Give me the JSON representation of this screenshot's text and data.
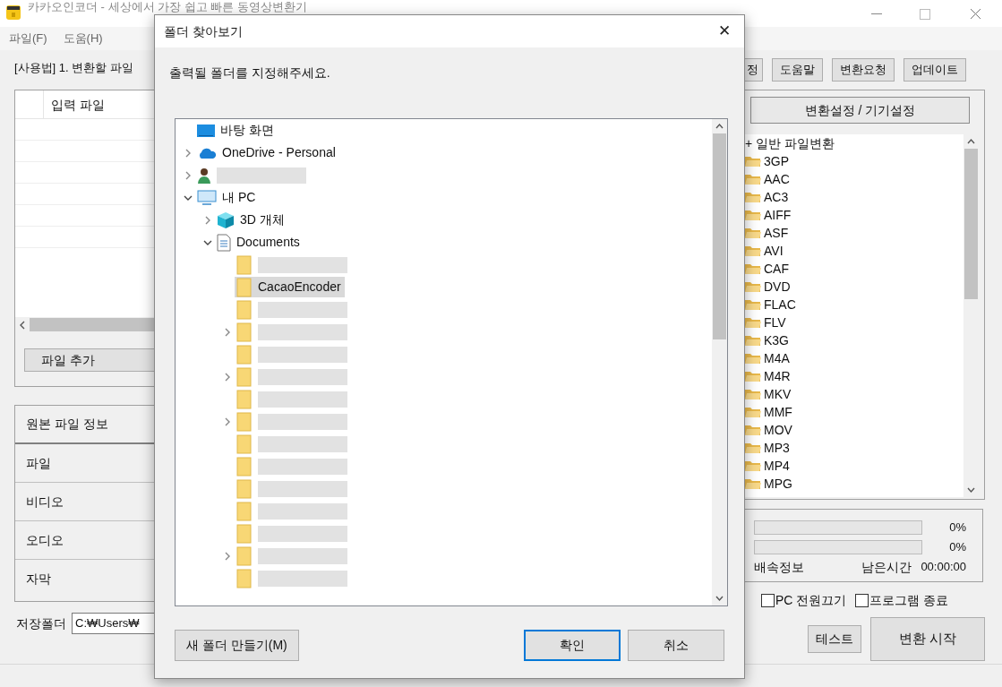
{
  "window": {
    "title": "카카오인코더 - 세상에서 가장 쉽고 빠른 동영상변환기"
  },
  "menu": [
    "파일(F)",
    "도움(H)"
  ],
  "usage": "[사용법] 1. 변환할 파일",
  "file_table": {
    "columns": [
      "입력 파일"
    ]
  },
  "add_file_button": "파일 추가",
  "source_info": {
    "title": "원본 파일 정보",
    "rows": [
      "파일",
      "비디오",
      "오디오",
      "자막"
    ]
  },
  "save_folder": {
    "label": "저장폴더",
    "value": "C:₩Users₩"
  },
  "top_buttons": [
    "정",
    "도움말",
    "변환요청",
    "업데이트"
  ],
  "settings_button": "변환설정 / 기기설정",
  "formats": {
    "header": "+ 일반 파일변환",
    "items": [
      "3GP",
      "AAC",
      "AC3",
      "AIFF",
      "ASF",
      "AVI",
      "CAF",
      "DVD",
      "FLAC",
      "FLV",
      "K3G",
      "M4A",
      "M4R",
      "MKV",
      "MMF",
      "MOV",
      "MP3",
      "MP4",
      "MPG"
    ]
  },
  "progress": [
    {
      "level": 0,
      "reading": "0%"
    },
    {
      "level": 0,
      "reading": "0%"
    }
  ],
  "speed_label": "배속정보",
  "remaining_label": "남은시간",
  "remaining_time": "00:00:00",
  "options": [
    {
      "label": "PC 전원끄기",
      "checked": false
    },
    {
      "label": "프로그램 종료",
      "checked": false
    }
  ],
  "test_button": "테스트",
  "start_button": "변환 시작",
  "dialog": {
    "title": "폴더 찾아보기",
    "close": "✕",
    "prompt": "출력될 폴더를 지정해주세요.",
    "tree": [
      {
        "kind": "desktop",
        "label": "바탕 화면",
        "selected": false
      },
      {
        "kind": "cloud",
        "label": "OneDrive - Personal",
        "expanded": false,
        "selected": false
      },
      {
        "kind": "user",
        "expanded": false,
        "selected": false
      },
      {
        "kind": "pc",
        "label": "내 PC",
        "expanded": true,
        "selected": false,
        "children": [
          {
            "kind": "cube",
            "label": "3D 개체",
            "expanded": false,
            "selected": false
          },
          {
            "kind": "document",
            "label": "Documents",
            "expanded": true,
            "selected": false,
            "children": [
              {
                "kind": "folder",
                "selected": false
              },
              {
                "kind": "folder",
                "label": "CacaoEncoder",
                "selected": true
              },
              {
                "kind": "folder",
                "selected": false
              },
              {
                "kind": "folder",
                "expanded": false,
                "selected": false
              },
              {
                "kind": "folder",
                "selected": false
              },
              {
                "kind": "folder",
                "expanded": false,
                "selected": false
              },
              {
                "kind": "folder",
                "selected": false
              },
              {
                "kind": "folder",
                "expanded": false,
                "selected": false
              },
              {
                "kind": "folder",
                "selected": false
              },
              {
                "kind": "folder",
                "selected": false
              },
              {
                "kind": "folder",
                "selected": false
              },
              {
                "kind": "folder",
                "selected": false
              },
              {
                "kind": "folder",
                "selected": false
              },
              {
                "kind": "folder",
                "expanded": false,
                "selected": false
              },
              {
                "kind": "folder",
                "selected": false
              }
            ]
          }
        ]
      }
    ],
    "buttons": [
      {
        "label": "새 폴더 만들기(M)",
        "default": false
      },
      {
        "label": "확인",
        "default": true
      },
      {
        "label": "취소",
        "default": false
      }
    ]
  }
}
